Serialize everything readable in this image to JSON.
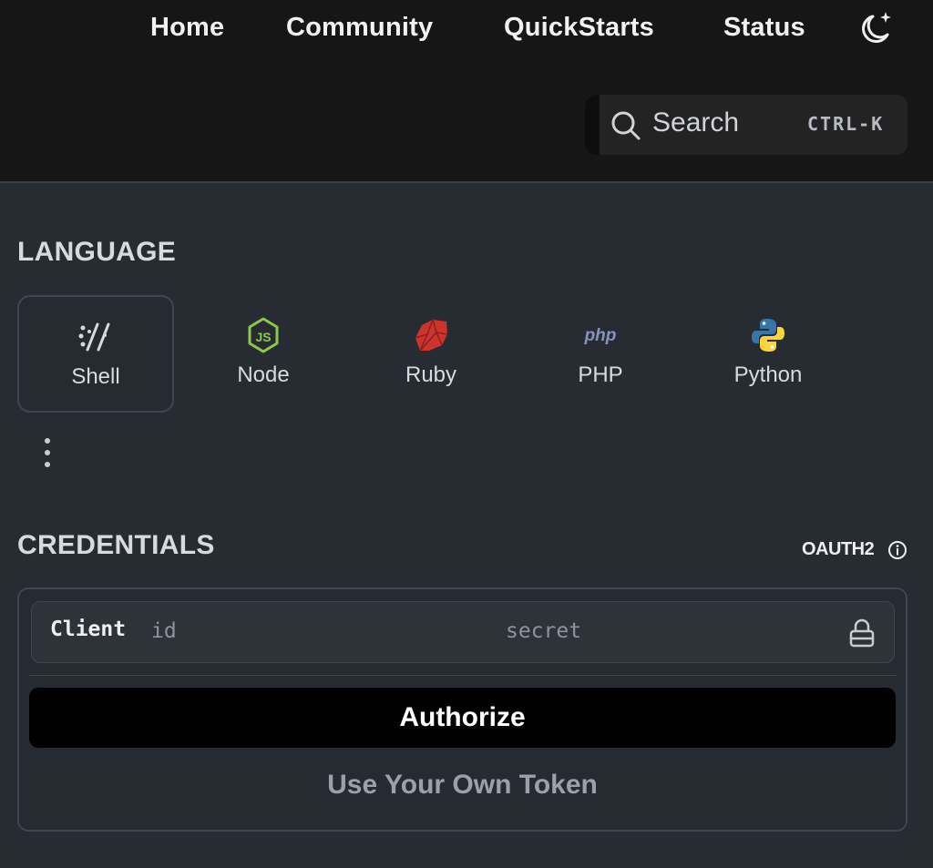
{
  "nav": {
    "links": [
      "Home",
      "Community",
      "QuickStarts",
      "Status"
    ],
    "theme_icon": "moon-sparkle-icon"
  },
  "search": {
    "label": "Search",
    "shortcut": "CTRL-K",
    "icon": "search-icon"
  },
  "language": {
    "title": "LANGUAGE",
    "selected": "Shell",
    "options": [
      {
        "label": "Shell",
        "icon": "shell-icon"
      },
      {
        "label": "Node",
        "icon": "nodejs-icon"
      },
      {
        "label": "Ruby",
        "icon": "ruby-icon"
      },
      {
        "label": "PHP",
        "icon": "php-icon"
      },
      {
        "label": "Python",
        "icon": "python-icon"
      }
    ],
    "more_icon": "more-vertical-icon"
  },
  "credentials": {
    "title": "CREDENTIALS",
    "auth_type": "OAUTH2",
    "client_label": "Client",
    "id_placeholder": "id",
    "secret_placeholder": "secret",
    "authorize_label": "Authorize",
    "own_token_label": "Use Your Own Token"
  },
  "colors": {
    "topbar_bg": "#161616",
    "page_bg": "#272c33",
    "button_bg": "#000000",
    "node_green": "#8cc84b",
    "ruby_red": "#cc342d",
    "php_purple": "#8892bf",
    "python_blue": "#3776ab",
    "python_yellow": "#ffd43b"
  }
}
